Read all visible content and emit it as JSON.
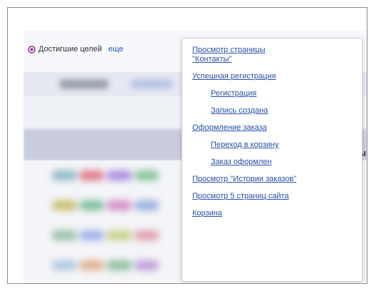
{
  "toolbar": {
    "goal_label": "Достигшие целей",
    "more_link": "еще"
  },
  "dropdown": {
    "items": [
      {
        "label": "Просмотр страницы \"Контакты\"",
        "level": 0
      },
      {
        "label": "Успешная регистрация",
        "level": 0
      },
      {
        "label": "Регистрация",
        "level": 1
      },
      {
        "label": "Запись создана",
        "level": 1
      },
      {
        "label": "Оформление заказа",
        "level": 0
      },
      {
        "label": "Переход в корзину",
        "level": 1
      },
      {
        "label": "Заказ оформлен",
        "level": 1
      },
      {
        "label": "Просмотр \"Истории заказов\"",
        "level": 0
      },
      {
        "label": "Просмотр 5 страниц сайта",
        "level": 0
      },
      {
        "label": "Корзина",
        "level": 0
      }
    ]
  },
  "colors": {
    "link": "#2a4fa8",
    "goal_icon": "#9b2a8f"
  }
}
